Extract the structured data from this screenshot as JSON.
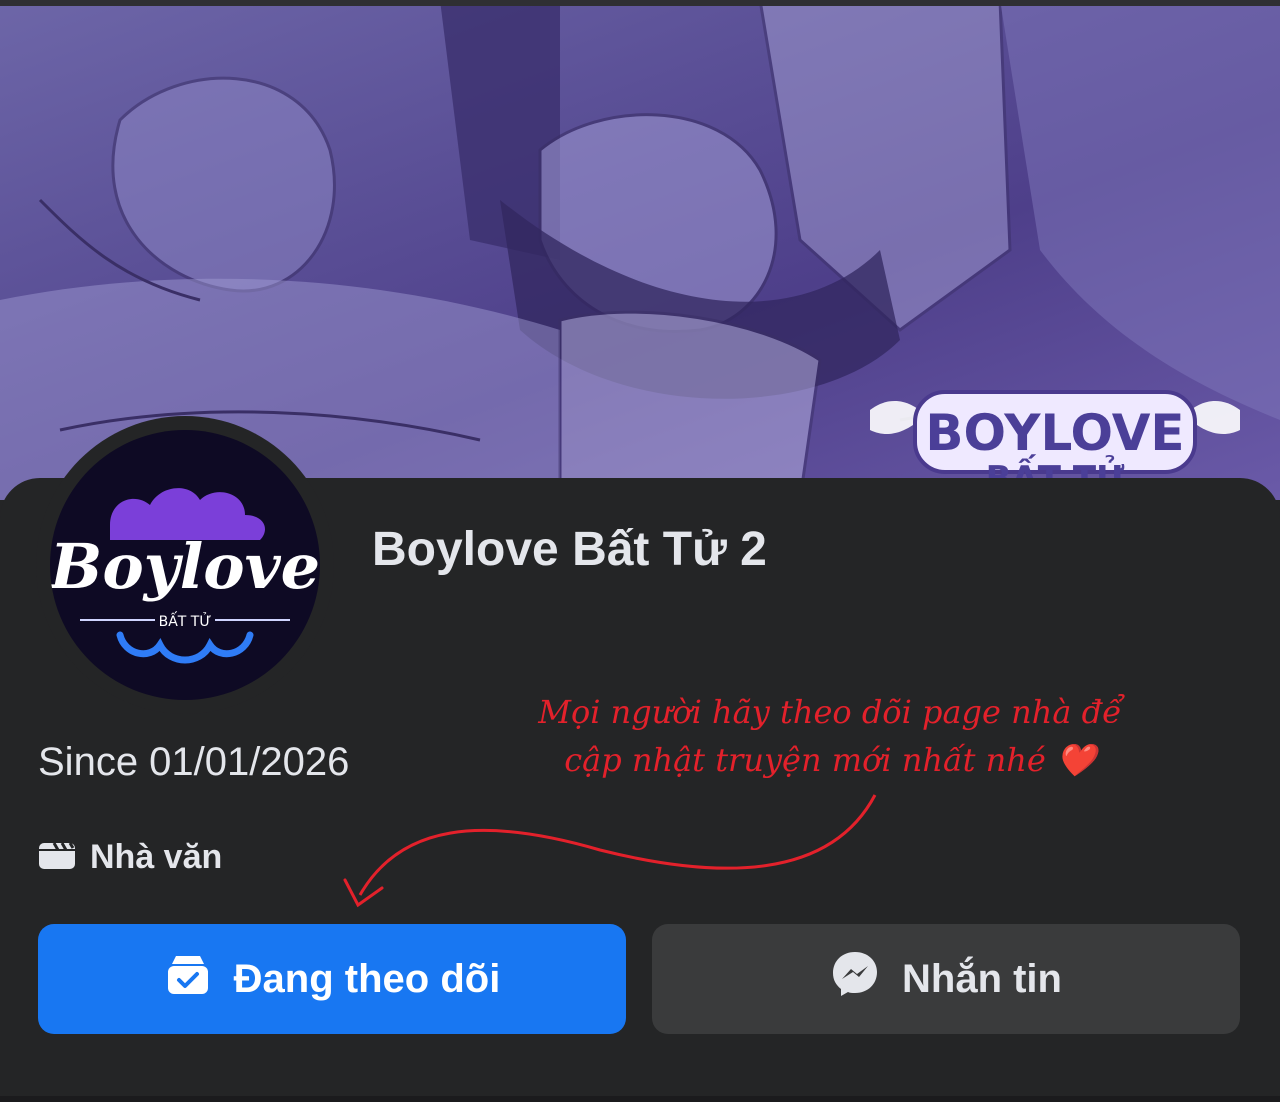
{
  "cover": {
    "watermark_text": [
      "BOYLOVE",
      "BẤT TỬ"
    ]
  },
  "profile": {
    "avatar_logo_text": "Boylove",
    "avatar_logo_sub": "BẤT TỬ",
    "name": "Boylove Bất Tử 2",
    "since": "Since 01/01/2026",
    "category_icon": "clapperboard-icon",
    "category": "Nhà văn"
  },
  "annotation": {
    "line1": "Mọi người hãy theo dõi page nhà để",
    "line2": "cập nhật truyện mới nhất nhé ❤️",
    "color": "#e3212b"
  },
  "actions": {
    "follow_label": "Đang theo dõi",
    "follow_icon": "following-check-icon",
    "follow_color": "#1877f2",
    "message_label": "Nhắn tin",
    "message_icon": "messenger-icon",
    "message_color": "#3a3b3c"
  }
}
